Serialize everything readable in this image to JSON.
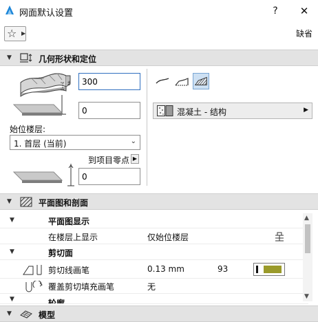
{
  "window": {
    "title": "网面默认设置",
    "help": "?",
    "close": "✕"
  },
  "toolbar": {
    "favorites_star": "☆",
    "favorites_arrow": "▶",
    "default_label": "缺省"
  },
  "geometry_section": {
    "title": "几何形状和定位",
    "thickness_value": "300",
    "offset_value": "0",
    "home_story_label": "始位楼层:",
    "home_story_value": "1. 首层 (当前)",
    "reference_label": "到项目零点",
    "reference_value": "0",
    "material_label": "混凝土 - 结构"
  },
  "plan_section": {
    "title": "平面图和剖面",
    "rows": [
      {
        "label": "平面图显示",
        "group": true
      },
      {
        "label": "在楼层上显示",
        "value": "仅始位楼层"
      },
      {
        "label": "剪切面",
        "group": true
      },
      {
        "label": "剪切线画笔",
        "value": "0.13 mm",
        "pen": "93"
      },
      {
        "label": "覆盖剪切填充画笔",
        "value": "无"
      },
      {
        "label": "轮廓"
      }
    ]
  },
  "model_section": {
    "title": "模型"
  },
  "colors": {
    "accent": "#2f6fbf",
    "pen_color": "#9a9a2a",
    "section_bg": "#e3e3e3"
  },
  "icons": [
    "archicad-icon",
    "star-icon",
    "mesh-icon",
    "view-icon",
    "model-icon"
  ]
}
